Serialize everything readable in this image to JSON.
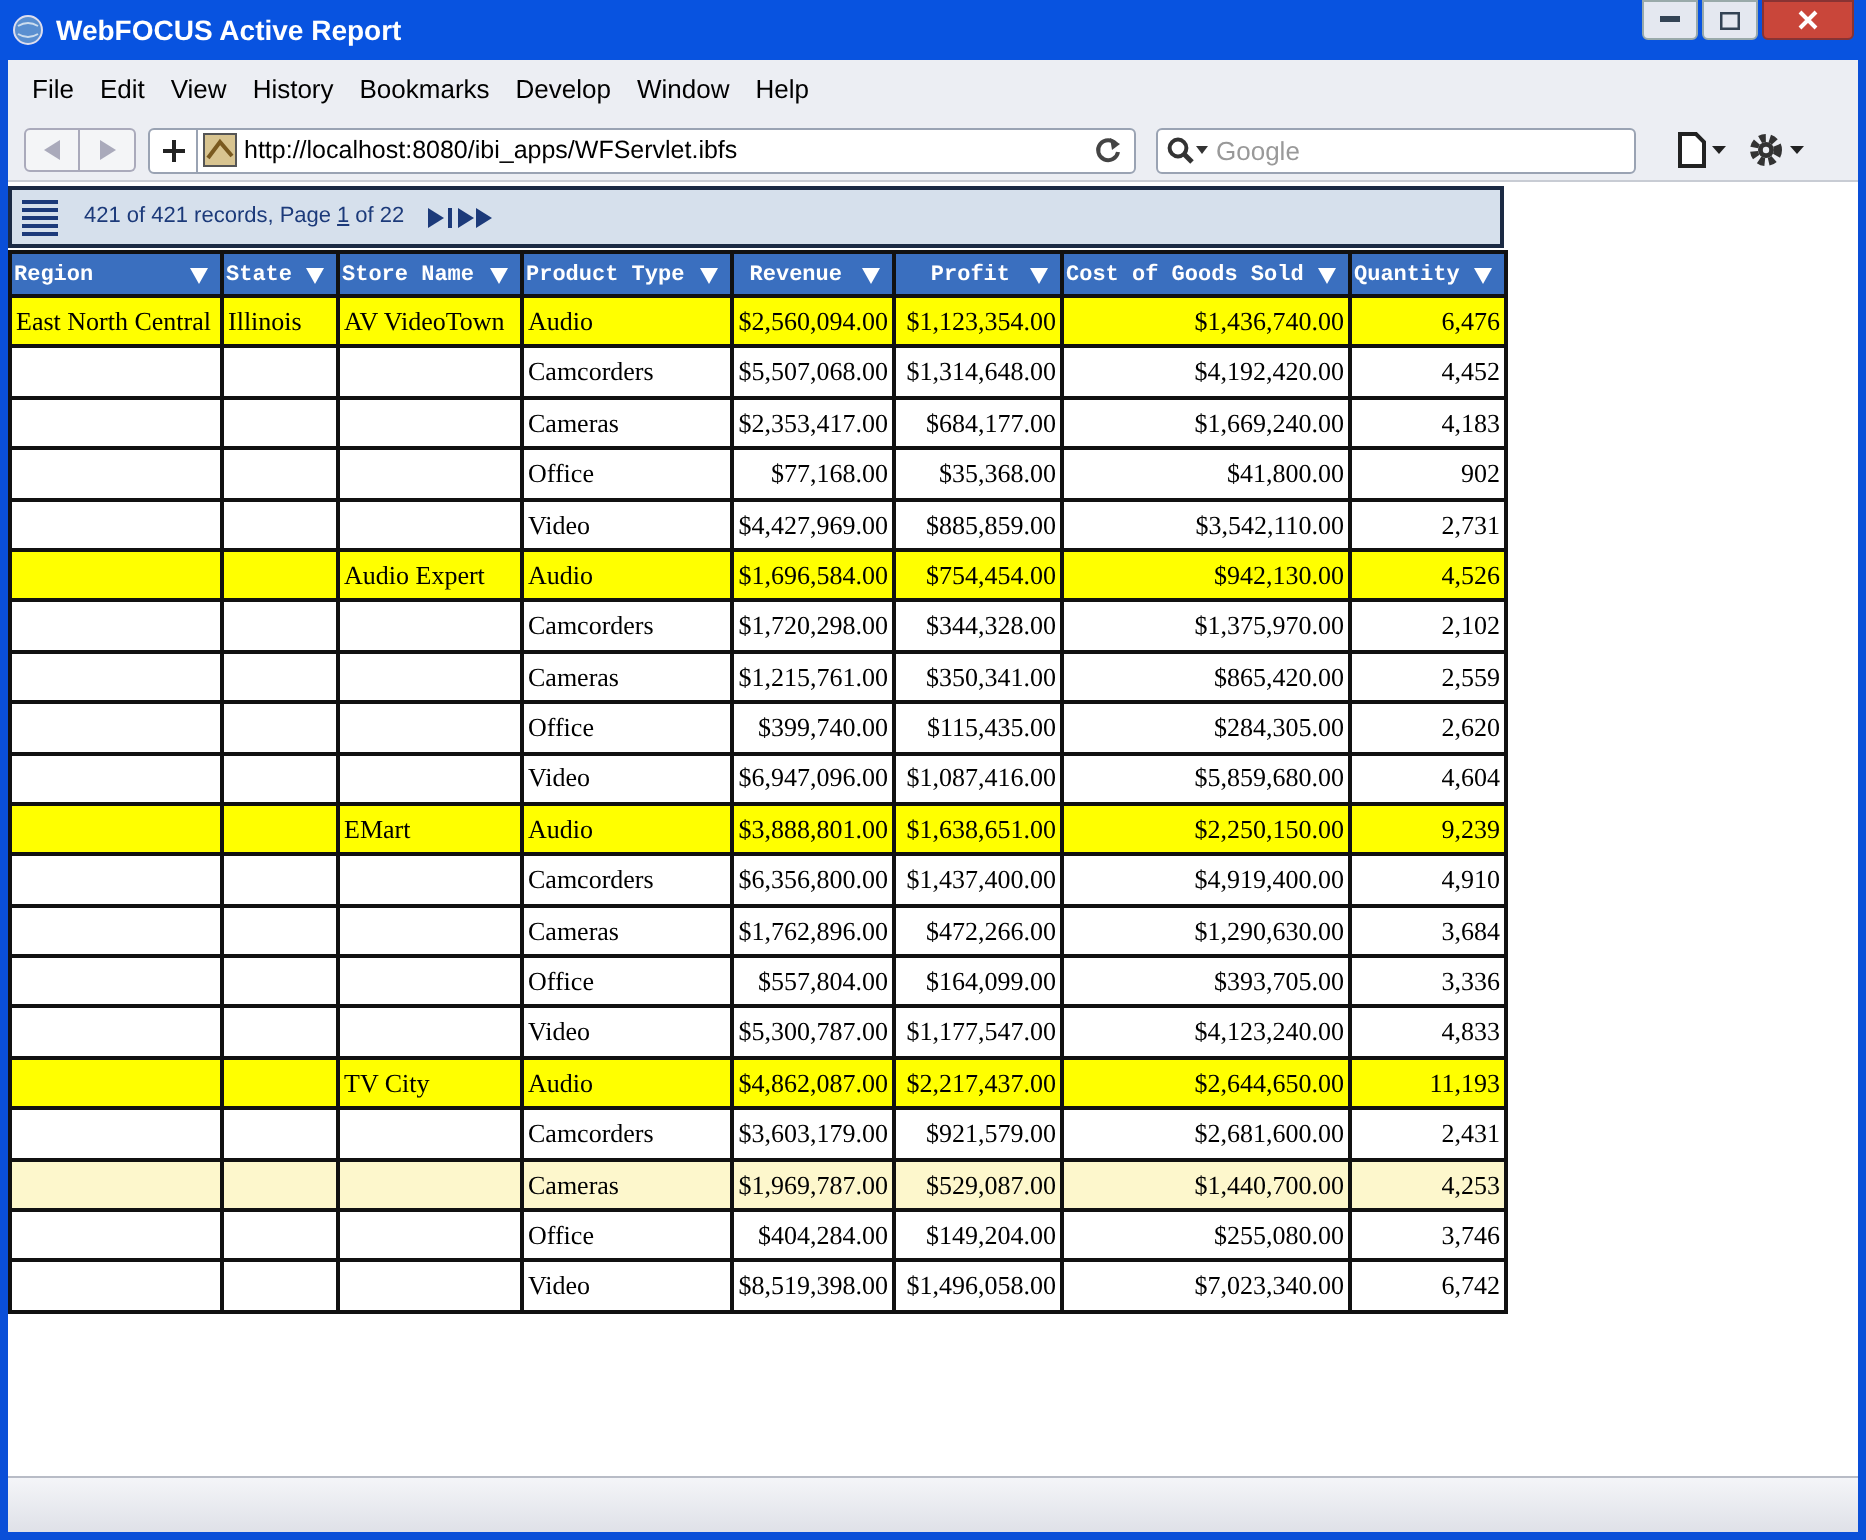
{
  "window": {
    "title": "WebFOCUS Active Report"
  },
  "menu": [
    "File",
    "Edit",
    "View",
    "History",
    "Bookmarks",
    "Develop",
    "Window",
    "Help"
  ],
  "address": {
    "value": "http://localhost:8080/ibi_apps/WFServlet.ibfs"
  },
  "search": {
    "placeholder": "Google"
  },
  "report_toolbar": {
    "records_text": "421 of 421 records, Page",
    "page": "1",
    "page_total_text": "of 22"
  },
  "table": {
    "columns": [
      {
        "label": "Region"
      },
      {
        "label": "State"
      },
      {
        "label": "Store Name"
      },
      {
        "label": "Product Type"
      },
      {
        "label": "Revenue"
      },
      {
        "label": "Profit"
      },
      {
        "label": "Cost of Goods Sold"
      },
      {
        "label": "Quantity"
      }
    ],
    "rows": [
      {
        "highlighted": true,
        "selected": false,
        "cells": [
          "East North Central",
          "Illinois",
          "AV VideoTown",
          "Audio",
          "$2,560,094.00",
          "$1,123,354.00",
          "$1,436,740.00",
          "6,476"
        ]
      },
      {
        "highlighted": false,
        "selected": false,
        "cells": [
          null,
          null,
          null,
          "Camcorders",
          "$5,507,068.00",
          "$1,314,648.00",
          "$4,192,420.00",
          "4,452"
        ]
      },
      {
        "highlighted": false,
        "selected": false,
        "cells": [
          null,
          null,
          null,
          "Cameras",
          "$2,353,417.00",
          "$684,177.00",
          "$1,669,240.00",
          "4,183"
        ]
      },
      {
        "highlighted": false,
        "selected": false,
        "cells": [
          null,
          null,
          null,
          "Office",
          "$77,168.00",
          "$35,368.00",
          "$41,800.00",
          "902"
        ]
      },
      {
        "highlighted": false,
        "selected": false,
        "cells": [
          null,
          null,
          null,
          "Video",
          "$4,427,969.00",
          "$885,859.00",
          "$3,542,110.00",
          "2,731"
        ]
      },
      {
        "highlighted": true,
        "selected": false,
        "cells": [
          null,
          null,
          "Audio Expert",
          "Audio",
          "$1,696,584.00",
          "$754,454.00",
          "$942,130.00",
          "4,526"
        ]
      },
      {
        "highlighted": false,
        "selected": false,
        "cells": [
          null,
          null,
          null,
          "Camcorders",
          "$1,720,298.00",
          "$344,328.00",
          "$1,375,970.00",
          "2,102"
        ]
      },
      {
        "highlighted": false,
        "selected": false,
        "cells": [
          null,
          null,
          null,
          "Cameras",
          "$1,215,761.00",
          "$350,341.00",
          "$865,420.00",
          "2,559"
        ]
      },
      {
        "highlighted": false,
        "selected": false,
        "cells": [
          null,
          null,
          null,
          "Office",
          "$399,740.00",
          "$115,435.00",
          "$284,305.00",
          "2,620"
        ]
      },
      {
        "highlighted": false,
        "selected": false,
        "cells": [
          null,
          null,
          null,
          "Video",
          "$6,947,096.00",
          "$1,087,416.00",
          "$5,859,680.00",
          "4,604"
        ]
      },
      {
        "highlighted": true,
        "selected": false,
        "cells": [
          null,
          null,
          "EMart",
          "Audio",
          "$3,888,801.00",
          "$1,638,651.00",
          "$2,250,150.00",
          "9,239"
        ]
      },
      {
        "highlighted": false,
        "selected": false,
        "cells": [
          null,
          null,
          null,
          "Camcorders",
          "$6,356,800.00",
          "$1,437,400.00",
          "$4,919,400.00",
          "4,910"
        ]
      },
      {
        "highlighted": false,
        "selected": false,
        "cells": [
          null,
          null,
          null,
          "Cameras",
          "$1,762,896.00",
          "$472,266.00",
          "$1,290,630.00",
          "3,684"
        ]
      },
      {
        "highlighted": false,
        "selected": false,
        "cells": [
          null,
          null,
          null,
          "Office",
          "$557,804.00",
          "$164,099.00",
          "$393,705.00",
          "3,336"
        ]
      },
      {
        "highlighted": false,
        "selected": false,
        "cells": [
          null,
          null,
          null,
          "Video",
          "$5,300,787.00",
          "$1,177,547.00",
          "$4,123,240.00",
          "4,833"
        ]
      },
      {
        "highlighted": true,
        "selected": false,
        "cells": [
          null,
          null,
          "TV City",
          "Audio",
          "$4,862,087.00",
          "$2,217,437.00",
          "$2,644,650.00",
          "11,193"
        ]
      },
      {
        "highlighted": false,
        "selected": false,
        "cells": [
          null,
          null,
          null,
          "Camcorders",
          "$3,603,179.00",
          "$921,579.00",
          "$2,681,600.00",
          "2,431"
        ]
      },
      {
        "highlighted": false,
        "selected": true,
        "cells": [
          null,
          null,
          null,
          "Cameras",
          "$1,969,787.00",
          "$529,087.00",
          "$1,440,700.00",
          "4,253"
        ]
      },
      {
        "highlighted": false,
        "selected": false,
        "cells": [
          null,
          null,
          null,
          "Office",
          "$404,284.00",
          "$149,204.00",
          "$255,080.00",
          "3,746"
        ]
      },
      {
        "highlighted": false,
        "selected": false,
        "cells": [
          null,
          null,
          null,
          "Video",
          "$8,519,398.00",
          "$1,496,058.00",
          "$7,023,340.00",
          "6,742"
        ]
      }
    ]
  }
}
